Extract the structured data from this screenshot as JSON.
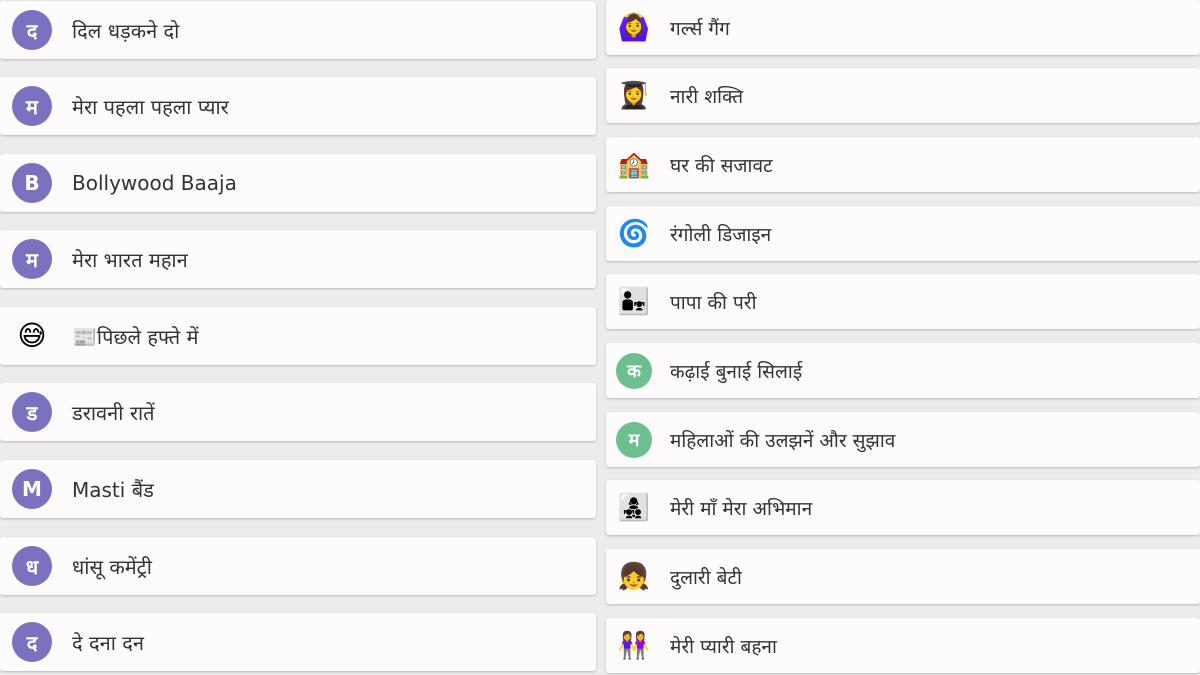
{
  "colors": {
    "avatar_purple": "#7b72bf",
    "avatar_green": "#6dbf8e",
    "card_bg": "#fdfbfb",
    "page_bg": "#ececec"
  },
  "left_groups": [
    {
      "avatar": "द",
      "label": "दिल धड़कने दो"
    },
    {
      "avatar": "म",
      "label": "मेरा पहला पहला प्यार"
    },
    {
      "avatar": "B",
      "label": "Bollywood Baaja"
    },
    {
      "avatar": "म",
      "label": "मेरा भारत महान"
    },
    {
      "emoji": "😅",
      "label": "📰पिछले हफ्ते में"
    },
    {
      "avatar": "ड",
      "label": "डरावनी रातें"
    },
    {
      "avatar": "M",
      "label": "Masti बैंड"
    },
    {
      "avatar": "ध",
      "label": "धांसू कमेंट्री"
    },
    {
      "avatar": "द",
      "label": "दे दना दन"
    }
  ],
  "right_groups": [
    {
      "emoji": "🙆‍♀️",
      "label": "गर्ल्स गैंग"
    },
    {
      "emoji": "👩‍🎓",
      "label": "नारी शक्ति"
    },
    {
      "emoji": "🏫",
      "label": "घर की सजावट"
    },
    {
      "emoji": "🌀",
      "label": "रंगोली डिजाइन"
    },
    {
      "emoji": "👨‍👧",
      "label": "पापा की परी"
    },
    {
      "avatar": "क",
      "label": "कढ़ाई बुनाई सिलाई"
    },
    {
      "avatar": "म",
      "label": "महिलाओं की उलझनें और सुझाव"
    },
    {
      "emoji": "👩‍👧‍👦",
      "label": "मेरी माँ मेरा अभिमान"
    },
    {
      "emoji": "👧",
      "label": "दुलारी बेटी"
    },
    {
      "emoji": "👭",
      "label": "मेरी प्यारी बहना"
    }
  ]
}
